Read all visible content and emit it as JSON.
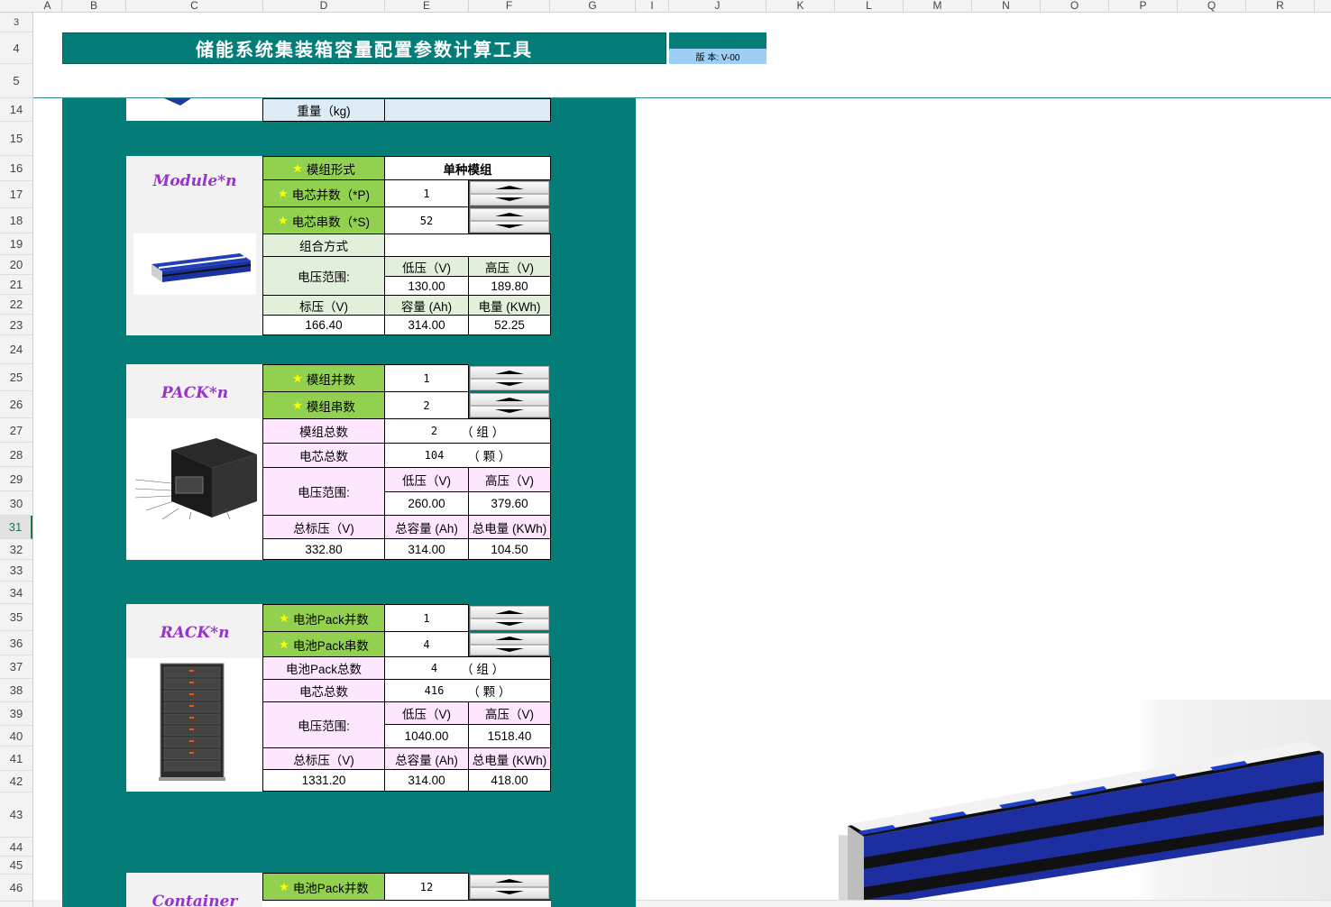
{
  "columns": [
    "A",
    "B",
    "C",
    "D",
    "E",
    "F",
    "G",
    "I",
    "J",
    "K",
    "L",
    "M",
    "N",
    "O",
    "P",
    "Q",
    "R"
  ],
  "rows": [
    "3",
    "4",
    "5",
    "14",
    "15",
    "16",
    "17",
    "18",
    "19",
    "20",
    "21",
    "22",
    "23",
    "24",
    "25",
    "26",
    "27",
    "28",
    "29",
    "30",
    "31",
    "32",
    "33",
    "34",
    "35",
    "36",
    "37",
    "38",
    "39",
    "40",
    "41",
    "42",
    "43",
    "44",
    "45",
    "46"
  ],
  "selected_row": "31",
  "title": "储能系统集装箱容量配置参数计算工具",
  "version": "版 本: V-00",
  "top_partial": {
    "label": "重量（kg)",
    "value": ""
  },
  "module": {
    "label": "Module*n",
    "rows": {
      "form_label": "模组形式",
      "form_value": "单种模组",
      "parallel_label": "电芯并数（*P)",
      "parallel_value": "1",
      "series_label": "电芯串数（*S)",
      "series_value": "52",
      "combo_label": "组合方式",
      "combo_value": "",
      "vrange_label": "电压范围:",
      "low_label": "低压（V)",
      "high_label": "高压（V)",
      "low_value": "130.00",
      "high_value": "189.80",
      "nominal_label": "标压（V)",
      "cap_label": "容量 (Ah)",
      "energy_label": "电量 (KWh)",
      "nominal_value": "166.40",
      "cap_value": "314.00",
      "energy_value": "52.25"
    }
  },
  "pack": {
    "label": "PACK*n",
    "rows": {
      "parallel_label": "模组并数",
      "parallel_value": "1",
      "series_label": "模组串数",
      "series_value": "2",
      "total_mod_label": "模组总数",
      "total_mod_value": "2",
      "total_mod_unit": "（ 组 ）",
      "total_cell_label": "电芯总数",
      "total_cell_value": "104",
      "total_cell_unit": "（ 颗 ）",
      "vrange_label": "电压范围:",
      "low_label": "低压（V)",
      "high_label": "高压（V)",
      "low_value": "260.00",
      "high_value": "379.60",
      "nominal_label": "总标压（V)",
      "cap_label": "总容量 (Ah)",
      "energy_label": "总电量 (KWh)",
      "nominal_value": "332.80",
      "cap_value": "314.00",
      "energy_value": "104.50"
    }
  },
  "rack": {
    "label": "RACK*n",
    "rows": {
      "parallel_label": "电池Pack并数",
      "parallel_value": "1",
      "series_label": "电池Pack串数",
      "series_value": "4",
      "total_pack_label": "电池Pack总数",
      "total_pack_value": "4",
      "total_pack_unit": "（ 组 ）",
      "total_cell_label": "电芯总数",
      "total_cell_value": "416",
      "total_cell_unit": "（ 颗 ）",
      "vrange_label": "电压范围:",
      "low_label": "低压（V)",
      "high_label": "高压（V)",
      "low_value": "1040.00",
      "high_value": "1518.40",
      "nominal_label": "总标压（V)",
      "cap_label": "总容量 (Ah)",
      "energy_label": "总电量 (KWh)",
      "nominal_value": "1331.20",
      "cap_value": "314.00",
      "energy_value": "418.00"
    }
  },
  "container": {
    "label": "Container",
    "rows": {
      "parallel_label": "电池Pack并数",
      "parallel_value": "12"
    }
  },
  "icons": {
    "star": "star-icon",
    "spinner_up": "triangle-up-icon",
    "spinner_down": "triangle-down-icon"
  },
  "colors": {
    "teal": "#047d78",
    "green": "#92d050",
    "pink": "#ffe6ff",
    "light_green": "#e2efda",
    "blue_light": "#ddebf7",
    "purple": "#9932cc",
    "version_blue": "#9dcff5"
  }
}
